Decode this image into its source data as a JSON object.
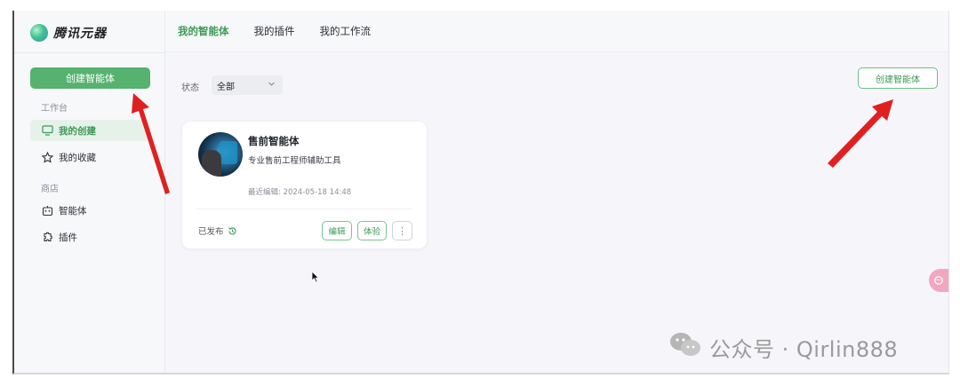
{
  "app": {
    "title": "腾讯元器",
    "brand_color": "#55b26f"
  },
  "topbar": {
    "tabs": [
      {
        "label": "我的智能体",
        "active": true
      },
      {
        "label": "我的插件"
      },
      {
        "label": "我的工作流"
      }
    ]
  },
  "sidebar": {
    "create_label": "创建智能体",
    "section_workbench": "工作台",
    "section_store": "商店",
    "items": [
      {
        "label": "我的创建",
        "icon": "monitor-icon",
        "active": true
      },
      {
        "label": "我的收藏",
        "icon": "star-icon"
      },
      {
        "label": "智能体",
        "icon": "robot-icon"
      },
      {
        "label": "插件",
        "icon": "puzzle-icon"
      }
    ]
  },
  "main": {
    "status_label": "状态",
    "status_value": "全部",
    "create_label": "创建智能体",
    "card": {
      "title": "售前智能体",
      "desc": "专业售前工程师辅助工具",
      "edit_time": "最近编辑: 2024-05-18 14:48",
      "status": "已发布",
      "edit": "编辑",
      "try": "体验",
      "more": "⋮"
    }
  },
  "watermark": {
    "text": "公众号 · Qirlin888"
  },
  "colors": {
    "annotation_arrow": "#e02020",
    "accent": "#3d9a57"
  }
}
